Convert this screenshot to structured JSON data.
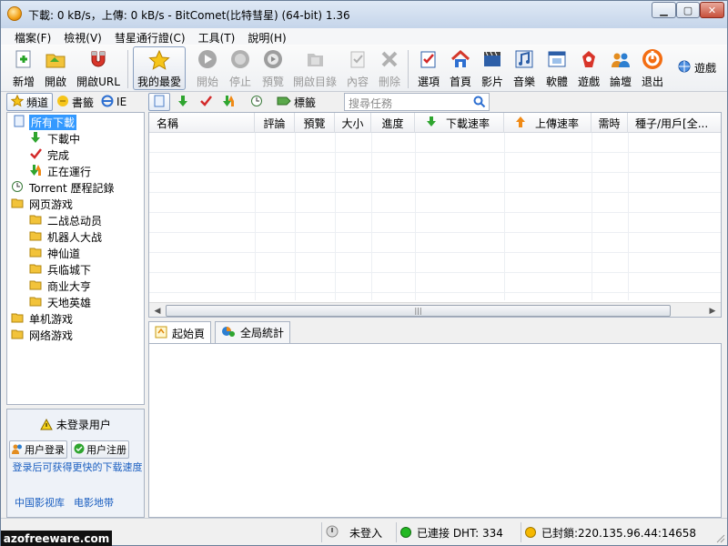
{
  "window": {
    "title": "下載: 0 kB/s，上傳: 0 kB/s - BitComet(比特彗星) (64-bit) 1.36",
    "controls": {
      "minimize": "▁",
      "maximize": "▢",
      "close": "✕"
    }
  },
  "menu": [
    "檔案(F)",
    "檢視(V)",
    "彗星通行證(C)",
    "工具(T)",
    "說明(H)"
  ],
  "toolbar": {
    "new": "新增",
    "open": "開啟",
    "open_url": "開啟URL",
    "favorites": "我的最愛",
    "start": "開始",
    "stop": "停止",
    "preview": "預覽",
    "open_dir": "開啟目錄",
    "content": "內容",
    "delete": "刪除",
    "options": "選項",
    "home": "首頁",
    "video": "影片",
    "music": "音樂",
    "software": "軟體",
    "games": "遊戲",
    "forum": "論壇",
    "exit": "退出",
    "search_game": "遊戲"
  },
  "left_tabs": {
    "channel": "頻道",
    "bookmarks": "書籤",
    "ie": "IE"
  },
  "tree": {
    "all_downloads": "所有下載",
    "downloading": "下載中",
    "completed": "完成",
    "running": "正在運行",
    "torrent_history": "Torrent 歷程記錄",
    "web_games": "网页游戏",
    "web_game_items": [
      "二战总动员",
      "机器人大战",
      "神仙道",
      "兵临城下",
      "商业大亨",
      "天地英雄"
    ],
    "single_games": "单机游戏",
    "net_games": "网络游戏"
  },
  "login": {
    "title": "未登录用户",
    "login_button": "用户登录",
    "register_button": "用户注册",
    "note": "登录后可获得更快的下载速度",
    "links": [
      "中国影视库",
      "电影地带"
    ]
  },
  "task_toolbar": {
    "tags": "標籤",
    "search_placeholder": "搜尋任務"
  },
  "columns": [
    "名稱",
    "評論",
    "預覽",
    "大小",
    "進度",
    "下載速率",
    "上傳速率",
    "需時",
    "種子/用戶[全..."
  ],
  "bottom_tabs": {
    "start_page": "起始頁",
    "global_stats": "全局統計"
  },
  "status": {
    "login": "未登入",
    "dht": "已連接 DHT: 334",
    "port": "已封鎖:220.135.96.44:14658"
  },
  "watermark": "azofreeware.com",
  "colors": {
    "selected": "#3399ff",
    "status_green": "#22b822",
    "status_yellow": "#f5b800",
    "link": "#1b5fc0"
  }
}
